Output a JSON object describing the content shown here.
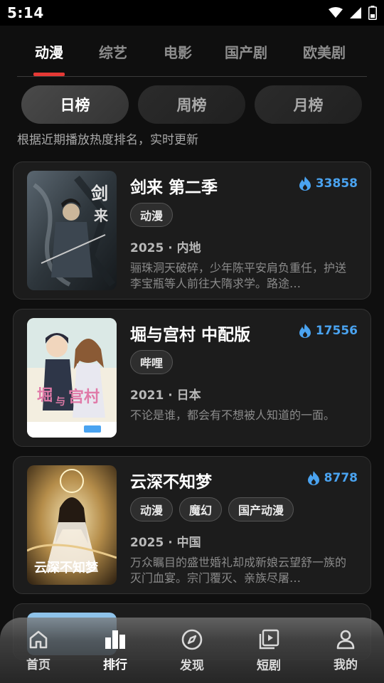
{
  "status": {
    "time": "5:14"
  },
  "category_tabs": [
    {
      "label": "动漫",
      "active": true
    },
    {
      "label": "综艺",
      "active": false
    },
    {
      "label": "电影",
      "active": false
    },
    {
      "label": "国产剧",
      "active": false
    },
    {
      "label": "欧美剧",
      "active": false
    }
  ],
  "rank_tabs": [
    {
      "label": "日榜",
      "active": true
    },
    {
      "label": "周榜",
      "active": false
    },
    {
      "label": "月榜",
      "active": false
    }
  ],
  "subtitle": "根据近期播放热度排名，实时更新",
  "items": [
    {
      "title": "剑来 第二季",
      "heat": "33858",
      "tags": [
        "动漫"
      ],
      "meta": "2025 · 内地",
      "desc": "骊珠洞天破碎，少年陈平安肩负重任，护送李宝瓶等人前往大隋求学。路途…"
    },
    {
      "title": "堀与宫村 中配版",
      "heat": "17556",
      "tags": [
        "哔哩"
      ],
      "meta": "2021 · 日本",
      "desc": "不论是谁，都会有不想被人知道的一面。"
    },
    {
      "title": "云深不知梦",
      "heat": "8778",
      "tags": [
        "动漫",
        "魔幻",
        "国产动漫"
      ],
      "meta": "2025 · 中国",
      "desc": "万众瞩目的盛世婚礼却成新娘云望舒一族的灭门血宴。宗门覆灭、亲族尽屠…"
    }
  ],
  "bottom_nav": [
    {
      "label": "首页",
      "icon": "home-icon",
      "active": false
    },
    {
      "label": "排行",
      "icon": "bar-chart-icon",
      "active": true
    },
    {
      "label": "发现",
      "icon": "compass-icon",
      "active": false
    },
    {
      "label": "短剧",
      "icon": "play-library-icon",
      "active": false
    },
    {
      "label": "我的",
      "icon": "person-icon",
      "active": false
    }
  ],
  "colors": {
    "accent": "#e53935",
    "heat": "#4aa3f0",
    "background": "#0f0f0f",
    "card": "#1c1c1c"
  }
}
